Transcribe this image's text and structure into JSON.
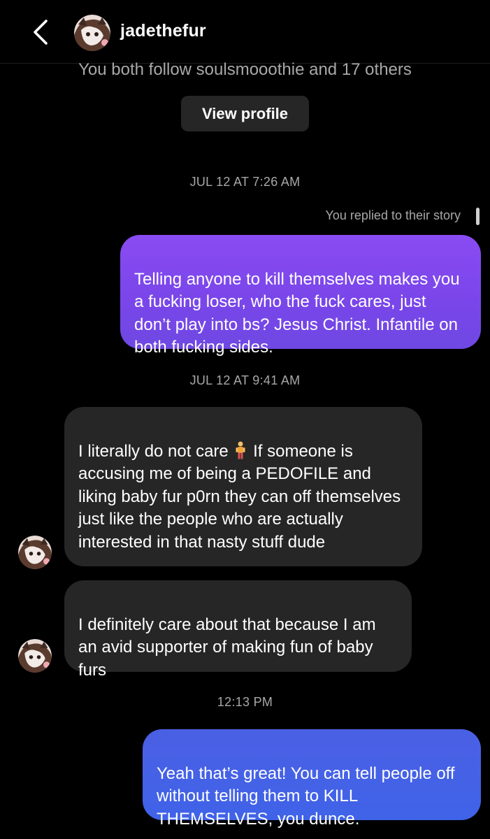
{
  "header": {
    "username": "jadethefur",
    "follow_info": "You both follow soulsmooothie and 17 others",
    "view_profile_label": "View profile"
  },
  "thread": {
    "timestamp_1": "JUL 12 AT 7:26 AM",
    "story_note": "You replied to their story",
    "msg1": "Telling anyone to kill themselves makes you a fucking loser, who the fuck cares, just don’t play into bs? Jesus Christ. Infantile on both fucking sides.",
    "timestamp_2": "JUL 12 AT 9:41 AM",
    "msg2_before_emoji": "I literally do not care ",
    "msg2_after_emoji": "  If someone is accusing me of being a PEDOFILE and liking baby fur p0rn they can off themselves just like the people who are actually interested in that nasty stuff dude",
    "msg3": "I definitely care about that because I am an avid supporter of making fun of baby furs",
    "timestamp_3": "12:13 PM",
    "msg4": "Yeah that’s great! You can tell people off without telling them to KILL THEMSELVES, you dunce."
  },
  "icons": {
    "back": "chevron-left-icon",
    "emoji": "standing-man-emoji"
  },
  "colors": {
    "background": "#000000",
    "received_bubble": "#262626",
    "sent_purple": "#7a46ea",
    "sent_blue": "#4261e6",
    "secondary_text": "#a8a8a8"
  }
}
